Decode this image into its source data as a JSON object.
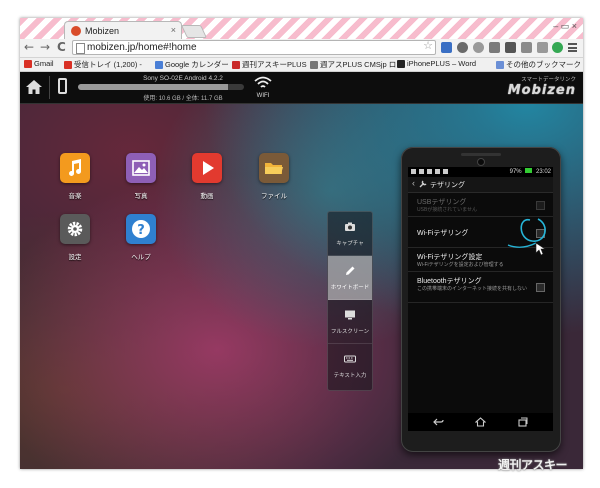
{
  "browser": {
    "tab_title": "Mobizen",
    "tab_close": "×",
    "url": "mobizen.jp/home#!home",
    "window_controls": "– ▭ ×",
    "nav": {
      "back": "←",
      "forward": "→",
      "reload": "C"
    },
    "bookmarks": [
      {
        "label": "Gmail",
        "color": "#d93025"
      },
      {
        "label": "受信トレイ (1,200) -",
        "color": "#d93025"
      },
      {
        "label": "Google カレンダー",
        "color": "#4a7fd6"
      },
      {
        "label": "週刊アスキーPLUS",
        "color": "#c92a2a"
      },
      {
        "label": "週アスPLUS CMSjp ロ",
        "color": "#777777"
      },
      {
        "label": "iPhonePLUS – Word",
        "color": "#222222"
      },
      {
        "label": "その他のブックマーク",
        "color": "#6b8fd6"
      }
    ]
  },
  "app": {
    "device_name": "Sony SO-02E Android 4.2.2",
    "storage_text": "使用: 10.6 GB / 全体: 11.7 GB",
    "storage_used_fraction": 0.906,
    "wifi_label": "WIFI",
    "brand_tagline": "スマートデータリンク",
    "brand_logo": "Mobizen",
    "icons": [
      {
        "label": "音楽",
        "color": "#f39a1e",
        "icon": "music-icon"
      },
      {
        "label": "写真",
        "color": "#8e5fb6",
        "icon": "photo-icon"
      },
      {
        "label": "動画",
        "color": "#e23a2f",
        "icon": "video-icon"
      },
      {
        "label": "ファイル",
        "color": "#7a5a38",
        "icon": "folder-icon"
      },
      {
        "label": "設定",
        "color": "#5a5a5a",
        "icon": "gear-icon"
      },
      {
        "label": "ヘルプ",
        "color": "#2f80d0",
        "icon": "help-icon"
      }
    ],
    "tools": [
      {
        "label": "キャプチャ",
        "icon": "camera-icon",
        "active": false
      },
      {
        "label": "ホワイトボード",
        "icon": "pencil-icon",
        "active": true
      },
      {
        "label": "フルスクリーン",
        "icon": "monitor-icon",
        "active": false
      },
      {
        "label": "テキスト入力",
        "icon": "keyboard-icon",
        "active": false
      }
    ]
  },
  "phone": {
    "status_time": "23:02",
    "status_battery": "97%",
    "screen_title": "テザリング",
    "items": [
      {
        "title": "USBテザリング",
        "subtitle": "USBが接続されていません",
        "disabled": true
      },
      {
        "title": "Wi-Fiテザリング",
        "subtitle": "",
        "disabled": false
      },
      {
        "title": "Wi-Fiテザリング設定",
        "subtitle": "Wi-Fiテザリングを設定および管理する",
        "disabled": false
      },
      {
        "title": "Bluetoothテザリング",
        "subtitle": "この携帯端末のインターネット接続を共有しない",
        "disabled": false
      }
    ]
  },
  "watermark": "週刊アスキー"
}
